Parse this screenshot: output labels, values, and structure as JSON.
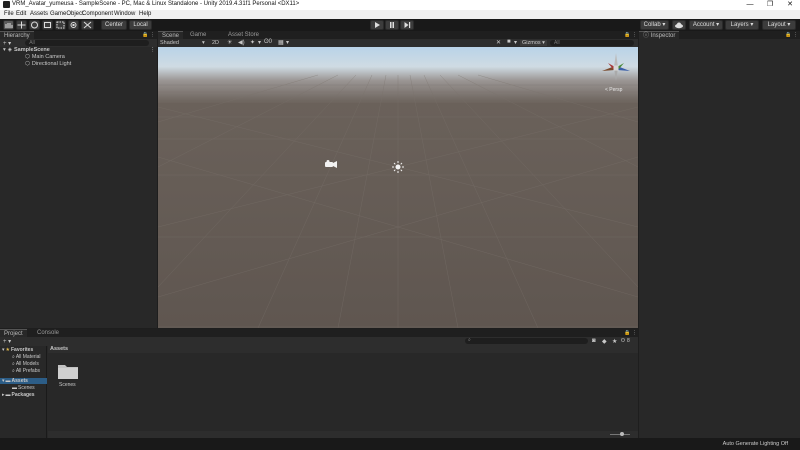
{
  "window": {
    "title": "VRM_Avatar_yumeusa - SampleScene - PC, Mac & Linux Standalone - Unity 2019.4.31f1 Personal <DX11>",
    "minimize": "—",
    "maximize": "❐",
    "close": "✕"
  },
  "menu": [
    "File",
    "Edit",
    "Assets",
    "GameObject",
    "Component",
    "Window",
    "Help"
  ],
  "toolbar": {
    "pivot": "Center",
    "space": "Local",
    "collab": "Collab ▾",
    "account": "Account",
    "layers": "Layers",
    "layout": "Layout"
  },
  "hierarchy": {
    "tab": "Hierarchy",
    "search_placeholder": "All",
    "scene": "SampleScene",
    "items": [
      "Main Camera",
      "Directional Light"
    ]
  },
  "scene": {
    "tabs": [
      "Scene",
      "Game",
      "Asset Store"
    ],
    "shading": "Shaded",
    "mode_2d": "2D",
    "gizmos": "Gizmos",
    "search_placeholder": "All",
    "persp": "< Persp"
  },
  "inspector": {
    "tab": "Inspector"
  },
  "project": {
    "tabs": [
      "Project",
      "Console"
    ],
    "favorites_label": "Favorites",
    "favorites": [
      "All Material",
      "All Models",
      "All Prefabs"
    ],
    "assets_label": "Assets",
    "assets_children": [
      "Scenes"
    ],
    "packages_label": "Packages",
    "breadcrumb": "Assets",
    "folder_name": "Scenes",
    "hidden_count": "8"
  },
  "status": {
    "text": "Auto Generate Lighting Off"
  },
  "colors": {
    "accent": "#3a72b0",
    "editor_bg": "#282828",
    "toolbar_bg": "#191919"
  }
}
